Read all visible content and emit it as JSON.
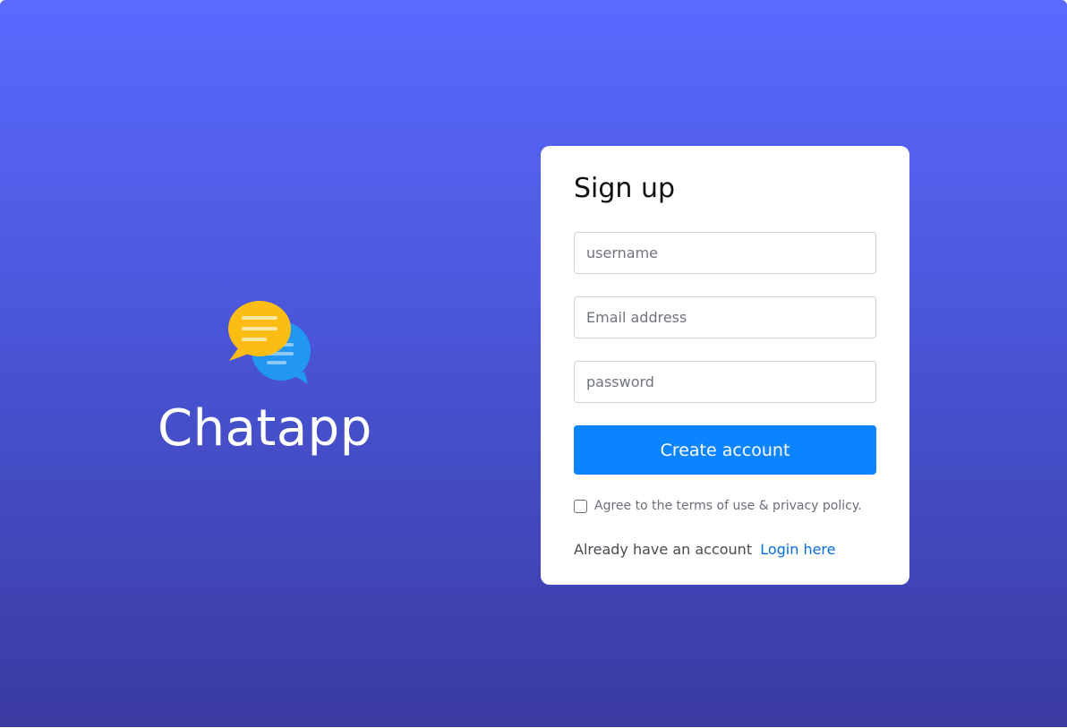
{
  "brand": {
    "name": "Chatapp",
    "logo_icon": "chat-bubbles-icon",
    "logo_colors": {
      "front_bubble": "#fbbc14",
      "back_bubble": "#2196f3"
    }
  },
  "signup": {
    "title": "Sign up",
    "fields": {
      "username": {
        "placeholder": "username",
        "value": ""
      },
      "email": {
        "placeholder": "Email address",
        "value": ""
      },
      "password": {
        "placeholder": "password",
        "value": ""
      }
    },
    "submit_label": "Create account",
    "terms": {
      "checked": false,
      "label": "Agree to the terms of use & privacy policy."
    },
    "login_prompt": "Already have an account",
    "login_link_label": "Login here"
  },
  "colors": {
    "background_top": "#5a6aff",
    "background_bottom": "#3a3aa0",
    "primary_button": "#0a84ff",
    "link": "#0a6fe0",
    "card": "#ffffff"
  }
}
